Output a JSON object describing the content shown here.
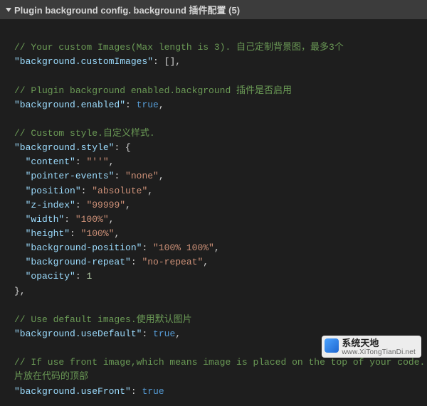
{
  "header": {
    "title": "Plugin background config. background 插件配置 (5)"
  },
  "lines": {
    "c1": "// Your custom Images(Max length is 3). 自己定制背景图，最多3个",
    "c2": "// Plugin background enabled.background 插件是否启用",
    "c3": "// Custom style.自定义样式.",
    "c4": "// Use default images.使用默认图片",
    "c5": "// If use front image,which means image is placed on the top of your code. 是否",
    "c5b": "片放在代码的顶部"
  },
  "settings": {
    "customImages": {
      "key": "\"background.customImages\"",
      "value": "[]"
    },
    "enabled": {
      "key": "\"background.enabled\"",
      "value": "true"
    },
    "styleKey": "\"background.style\"",
    "style": {
      "content": {
        "key": "\"content\"",
        "value": "\"''\""
      },
      "pe": {
        "key": "\"pointer-events\"",
        "value": "\"none\""
      },
      "position": {
        "key": "\"position\"",
        "value": "\"absolute\""
      },
      "zindex": {
        "key": "\"z-index\"",
        "value": "\"99999\""
      },
      "width": {
        "key": "\"width\"",
        "value": "\"100%\""
      },
      "height": {
        "key": "\"height\"",
        "value": "\"100%\""
      },
      "bgpos": {
        "key": "\"background-position\"",
        "value": "\"100% 100%\""
      },
      "bgrep": {
        "key": "\"background-repeat\"",
        "value": "\"no-repeat\""
      },
      "opacity": {
        "key": "\"opacity\"",
        "value": "1"
      }
    },
    "useDefault": {
      "key": "\"background.useDefault\"",
      "value": "true"
    },
    "useFront": {
      "key": "\"background.useFront\"",
      "value": "true"
    }
  },
  "watermark": {
    "title": "系统天地",
    "url": "www.XiTongTianDi.net"
  }
}
